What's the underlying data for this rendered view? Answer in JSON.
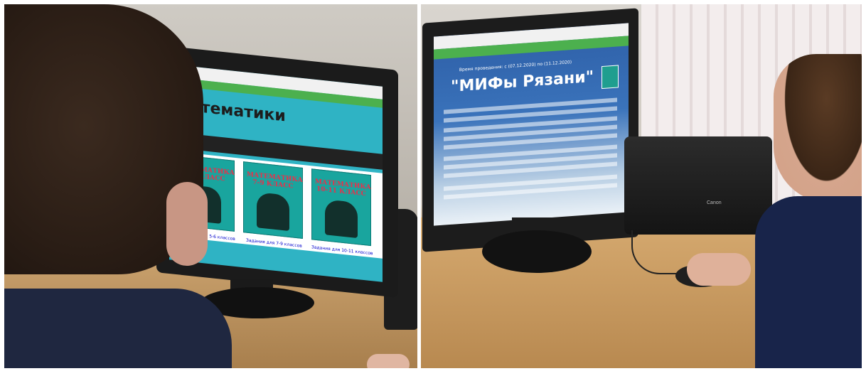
{
  "left_photo": {
    "screen_heading": "Математики",
    "cards": [
      {
        "title": "МАТЕМАТИКА 5-6 КЛАСС",
        "caption": "Задания для 5-6 классов"
      },
      {
        "title": "МАТЕМАТИКА 7-9 КЛАСС",
        "caption": "Задания для 7-9 классов"
      },
      {
        "title": "МАТЕМАТИКА 10-11 КЛАСС",
        "caption": "Задания для 10-11 классов"
      }
    ]
  },
  "right_photo": {
    "screen_dates": "Время проведения: с (07.12.2020) по (11.12.2020)",
    "screen_title": "\"МИФы Рязани\"",
    "printer_brand": "Canon"
  },
  "colors": {
    "site_green": "#4cb04e",
    "teal_banner": "#2fb3c4",
    "sky_blue": "#2e5fa7",
    "desk": "#c8a06c"
  }
}
